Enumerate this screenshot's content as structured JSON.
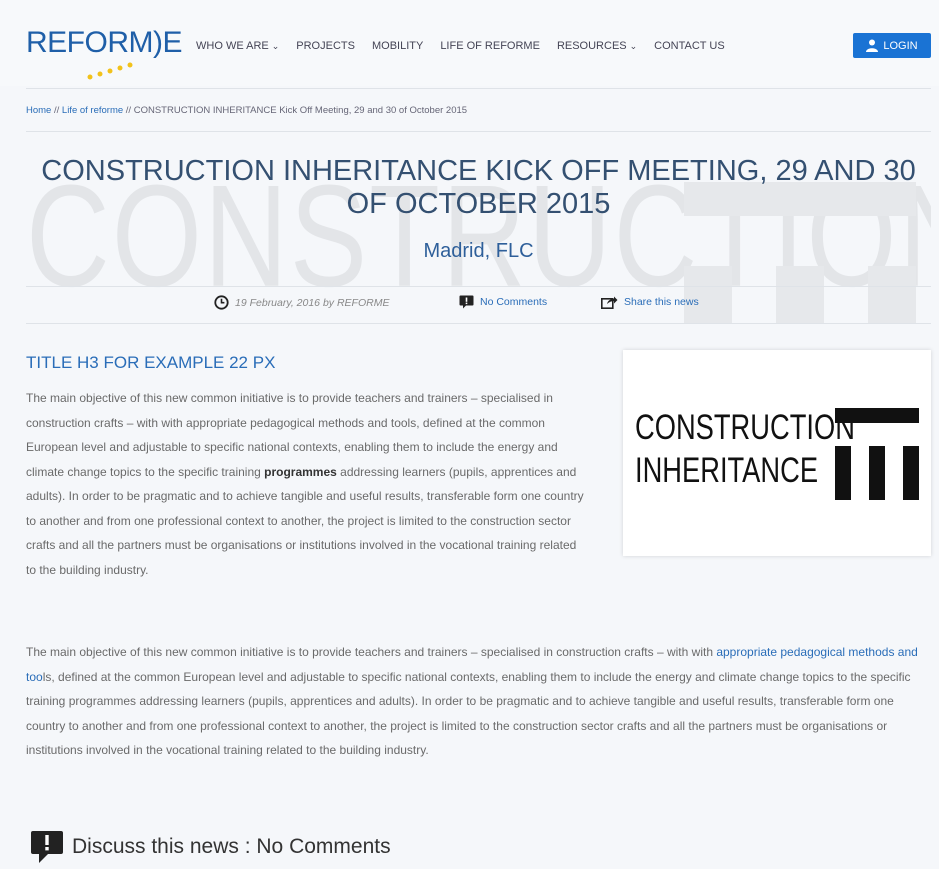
{
  "brand": {
    "logo_text": "REFORM",
    "logo_bracket": ")",
    "logo_tail": "E"
  },
  "nav": {
    "items": [
      {
        "label": "WHO WE ARE",
        "has_caret": true
      },
      {
        "label": "PROJECTS",
        "has_caret": false
      },
      {
        "label": "MOBILITY",
        "has_caret": false
      },
      {
        "label": "LIFE OF REFORME",
        "has_caret": false
      },
      {
        "label": "RESOURCES",
        "has_caret": true
      },
      {
        "label": "CONTACT US",
        "has_caret": false
      }
    ],
    "caret": "⌄",
    "login_label": "LOGIN"
  },
  "breadcrumb": {
    "home": "Home",
    "sep": " // ",
    "section": "Life of reforme",
    "current": "CONSTRUCTION INHERITANCE Kick Off Meeting, 29 and 30 of October 2015"
  },
  "hero": {
    "background_word": "CONSTRUCTION",
    "title": "CONSTRUCTION INHERITANCE KICK OFF MEETING, 29 AND 30 OF OCTOBER 2015",
    "subtitle": "Madrid, FLC"
  },
  "meta": {
    "date": "19 February, 2016 by REFORME",
    "comments": "No Comments",
    "share": "Share this news"
  },
  "article": {
    "h3": "TITLE H3 FOR EXAMPLE 22 PX",
    "p1_before": "The main objective of this new common initiative is to provide teachers and trainers – specialised in construction crafts – with with appropriate pedagogical methods and tools, defined at the common European level and adjustable to specific national contexts, enabling them to include the energy and climate change topics to the specific training ",
    "p1_bold": "programmes",
    "p1_after": " addressing learners (pupils, apprentices and adults). In order to be pragmatic and to achieve tangible and useful results, transferable form one country to another and from one professional context to another, the project is limited to the construction sector crafts and all the partners must be organisations or institutions involved in the vocational training related to the building industry.",
    "p2_before": "The main objective of this new common initiative is to provide teachers and trainers – specialised in construction crafts – with with ",
    "p2_link": "appropriate pedagogical methods and too",
    "p2_after": "ls, defined at the common European level and adjustable to specific national contexts, enabling them to include the energy and climate change topics to the specific training programmes addressing learners (pupils, apprentices and adults). In order to be pragmatic and to achieve tangible and useful results, transferable form one country to another and from one professional context to another, the project is limited to the construction sector crafts and all the partners must be organisations or institutions involved in the vocational training related to the building industry."
  },
  "image_card": {
    "line1": "CONSTRUCTION",
    "line2": "INHERITANCE"
  },
  "discuss": {
    "label": "Discuss this news : No Comments"
  },
  "colors": {
    "accent": "#2a6db8",
    "login_bg": "#1a73d4",
    "title": "#345071",
    "text": "#6a6a6a"
  }
}
